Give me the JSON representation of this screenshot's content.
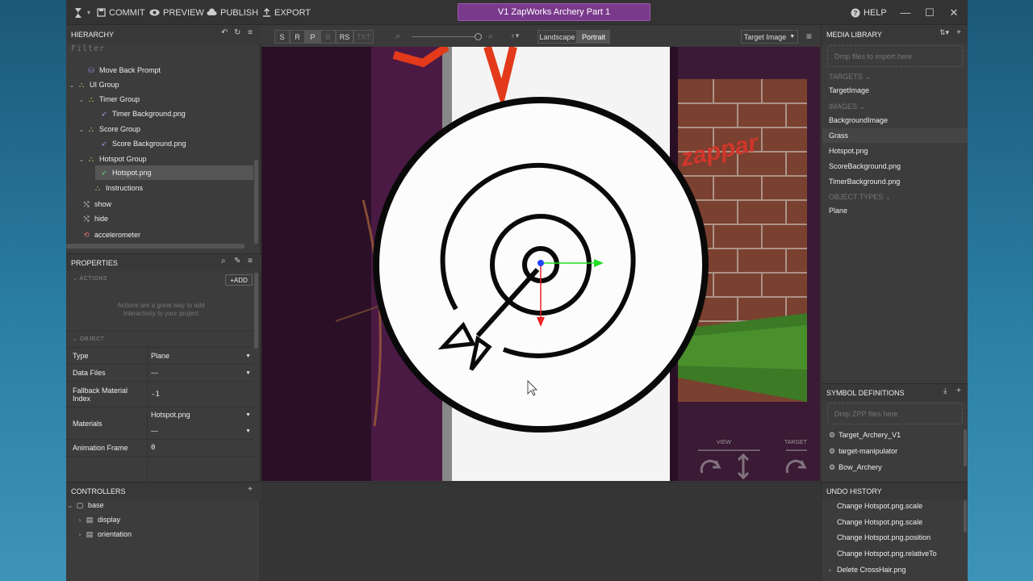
{
  "toolbar": {
    "commit": "COMMIT",
    "preview": "PREVIEW",
    "publish": "PUBLISH",
    "export": "EXPORT",
    "help": "HELP",
    "project_title": "V1 ZapWorks Archery Part 1"
  },
  "hierarchy": {
    "title": "HIERARCHY",
    "filter_placeholder": "Filter",
    "items": [
      {
        "label": "Move Back Prompt",
        "icon": "move-icon",
        "selected": false
      },
      {
        "label": "UI Group",
        "icon": "group-icon",
        "selected": false
      },
      {
        "label": "Timer Group",
        "icon": "group-icon",
        "selected": false
      },
      {
        "label": "Timer Background.png",
        "icon": "image-plane-icon",
        "selected": false
      },
      {
        "label": "Score Group",
        "icon": "group-icon",
        "selected": false
      },
      {
        "label": "Score Background.png",
        "icon": "image-plane-icon",
        "selected": false
      },
      {
        "label": "Hotspot Group",
        "icon": "group-icon",
        "selected": false
      },
      {
        "label": "Hotspot.png",
        "icon": "image-plane-icon",
        "selected": true
      },
      {
        "label": "Instructions",
        "icon": "group-icon",
        "selected": false
      },
      {
        "label": "show",
        "icon": "state-icon",
        "selected": false
      },
      {
        "label": "hide",
        "icon": "state-icon",
        "selected": false
      },
      {
        "label": "accelerometer",
        "icon": "sensor-icon",
        "selected": false
      }
    ]
  },
  "properties": {
    "title": "PROPERTIES",
    "actions_header": "ACTIONS",
    "add_label": "ADD",
    "actions_hint": "Actions are a great way to add interactivity to your project",
    "object_header": "OBJECT",
    "rows": [
      {
        "label": "Type",
        "value": "Plane"
      },
      {
        "label": "Data Files",
        "value": "---"
      },
      {
        "label": "Fallback Material Index",
        "value": "-1"
      },
      {
        "label": "Materials",
        "value": "Hotspot.png",
        "value2": "---"
      },
      {
        "label": "Animation Frame",
        "value": "0"
      }
    ]
  },
  "controllers": {
    "title": "CONTROLLERS",
    "items": [
      {
        "label": "base"
      },
      {
        "label": "display"
      },
      {
        "label": "orientation"
      }
    ]
  },
  "viewport_toolbar": {
    "modes": [
      "S",
      "R",
      "P",
      "B",
      "RS",
      "TXT"
    ],
    "landscape": "Landscape",
    "portrait": "Portrait",
    "target_select": "Target Image",
    "zoom_level": 1.0
  },
  "viewport": {
    "view_label": "VIEW",
    "target_label": "TARGET",
    "brand_text": "zappar"
  },
  "media_library": {
    "title": "MEDIA LIBRARY",
    "drop_hint": "Drop files to import here",
    "targets_header": "TARGETS",
    "targets": [
      "TargetImage"
    ],
    "images_header": "IMAGES",
    "images": [
      "BackgroundImage",
      "Grass",
      "Hotspot.png",
      "ScoreBackground.png",
      "TimerBackground.png"
    ],
    "object_types_header": "OBJECT TYPES",
    "object_types": [
      "Plane"
    ]
  },
  "symbols": {
    "title": "SYMBOL DEFINITIONS",
    "drop_hint": "Drop ZPP files here",
    "items": [
      "Target_Archery_V1",
      "target-manipulator",
      "Bow_Archery"
    ]
  },
  "undo": {
    "title": "UNDO HISTORY",
    "items": [
      "Change Hotspot.png.scale",
      "Change Hotspot.png.scale",
      "Change Hotspot.png.position",
      "Change Hotspot.png.relativeTo",
      "Delete CrossHair.png"
    ]
  },
  "colors": {
    "accent": "#7a3a8c",
    "panel": "#3c3c3c",
    "gizmo_x": "#22dd22",
    "gizmo_y": "#ee2222",
    "gizmo_z": "#2244ff"
  }
}
